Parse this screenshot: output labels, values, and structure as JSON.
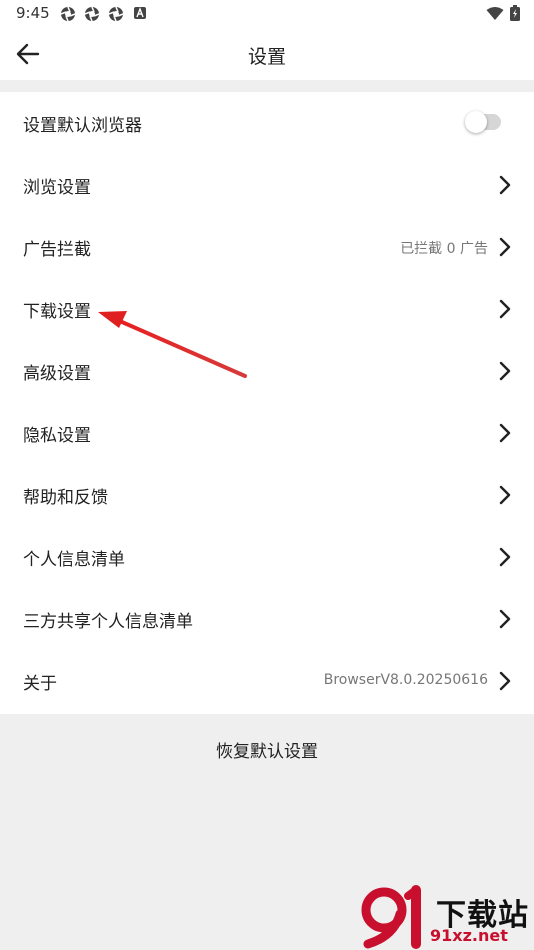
{
  "status_bar": {
    "time": "9:45",
    "left_icons": [
      "aperture-icon",
      "aperture-icon",
      "aperture-icon",
      "notification-a-icon"
    ],
    "right_icons": [
      "wifi-icon",
      "battery-icon"
    ]
  },
  "app_bar": {
    "title": "设置",
    "back_icon": "back-arrow-icon"
  },
  "settings": {
    "items": [
      {
        "label": "设置默认浏览器",
        "control": "toggle",
        "toggle_on": false
      },
      {
        "label": "浏览设置",
        "control": "chevron"
      },
      {
        "label": "广告拦截",
        "value": "已拦截 0 广告",
        "control": "chevron"
      },
      {
        "label": "下载设置",
        "control": "chevron"
      },
      {
        "label": "高级设置",
        "control": "chevron"
      },
      {
        "label": "隐私设置",
        "control": "chevron"
      },
      {
        "label": "帮助和反馈",
        "control": "chevron"
      },
      {
        "label": "个人信息清单",
        "control": "chevron"
      },
      {
        "label": "三方共享个人信息清单",
        "control": "chevron"
      },
      {
        "label": "关于",
        "value": "BrowserV8.0.20250616",
        "control": "chevron"
      }
    ]
  },
  "reset_button": {
    "label": "恢复默认设置"
  },
  "annotation": {
    "arrow_color": "#e02020"
  },
  "watermark": {
    "text_cn": "下载站",
    "url": "91xz.net",
    "logo_color": "#c8102e"
  },
  "colors": {
    "background": "#efefef",
    "surface": "#ffffff",
    "text": "#222222",
    "secondary_text": "#777777"
  }
}
